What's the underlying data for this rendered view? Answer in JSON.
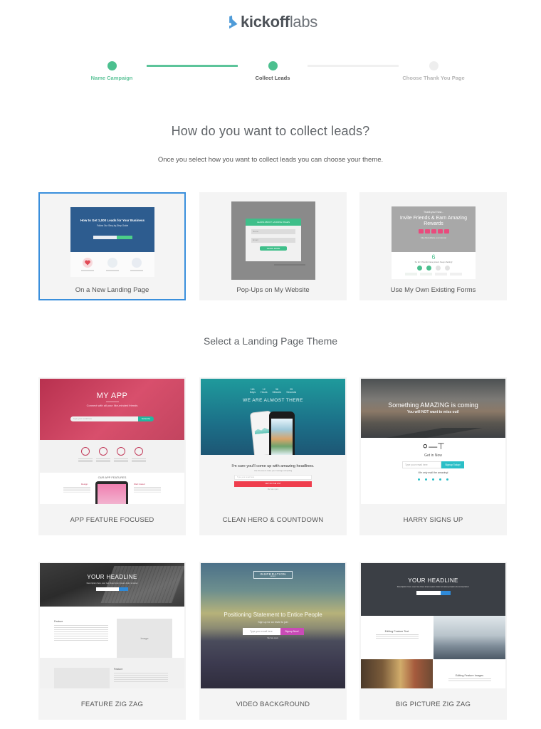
{
  "brand": {
    "name_bold": "kickoff",
    "name_light": "labs",
    "logo_icon": "flask-icon"
  },
  "stepper": {
    "steps": [
      {
        "label": "Name Campaign",
        "state": "completed"
      },
      {
        "label": "Collect Leads",
        "state": "current"
      },
      {
        "label": "Choose Thank You Page",
        "state": "upcoming"
      }
    ],
    "accent_color": "#4cc08f"
  },
  "collect": {
    "title": "How do you want to collect leads?",
    "subtitle": "Once you select how you want to collect leads you can choose your theme.",
    "options": [
      {
        "label": "On a New Landing Page",
        "selected": true,
        "preview": {
          "headline": "How to Get 1,000 Leads for Your Business",
          "subline": "Follow Our Step-by-Step Guide"
        }
      },
      {
        "label": "Pop-Ups on My Website",
        "selected": false,
        "preview": {
          "header": "LEARN ABOUT LANDING PAGES",
          "name_placeholder": "Name",
          "email_placeholder": "Email",
          "button": "LEARN MORE"
        }
      },
      {
        "label": "Use My Own Existing Forms",
        "selected": false,
        "preview": {
          "kicker": "Thank you! Now...",
          "headline": "Invite Friends & Earn Amazing Rewards",
          "count": "6",
          "count_text": "So far 6 friends have joined. Keep sharing!"
        }
      }
    ],
    "selected_color": "#3a8fdc"
  },
  "themes": {
    "title": "Select a Landing Page Theme",
    "items": [
      {
        "label": "APP FEATURE FOCUSED",
        "preview": {
          "title": "MY APP",
          "tagline": "Connect with all your like-minded friends",
          "email_placeholder": "Type your email here",
          "button": "Subscribe",
          "features_heading": "OUR APP FEATURES",
          "left_feature": "Design",
          "right_feature": "Well Coded"
        }
      },
      {
        "label": "CLEAN HERO & COUNTDOWN",
        "preview": {
          "countdown": [
            {
              "value": "161",
              "unit": "Days"
            },
            {
              "value": "12",
              "unit": "Hours"
            },
            {
              "value": "36",
              "unit": "Minutes"
            },
            {
              "value": "25",
              "unit": "Seconds"
            }
          ],
          "headline": "WE ARE ALMOST THERE",
          "body_headline": "I'm sure you'll come up with amazing headlines.",
          "email_placeholder": "Type your email here",
          "button": "GET ON THE LIST"
        }
      },
      {
        "label": "HARRY SIGNS UP",
        "preview": {
          "headline": "Something AMAZING is coming",
          "subline": "You will NOT want to miss out!",
          "cta_heading": "Get in Now",
          "email_placeholder": "Type your email here",
          "button": "Signup Today!",
          "footnote": "We only mail the amazing!"
        }
      },
      {
        "label": "FEATURE ZIG ZAG",
        "preview": {
          "headline": "YOUR HEADLINE",
          "feature_title": "Feature",
          "image_label": "Image"
        }
      },
      {
        "label": "VIDEO BACKGROUND",
        "preview": {
          "logo": "INSPERATION",
          "logo_sub": "GROUP",
          "headline": "Positioning Statement to Entice People",
          "subline": "Sign up for an invite to join",
          "email_placeholder": "Type your email here",
          "button": "Signup Now!",
          "footnote": "We hate spam."
        }
      },
      {
        "label": "BIG PICTURE ZIG ZAG",
        "preview": {
          "headline": "YOUR HEADLINE",
          "description": "Description here over two lines lorem ipsum dolor sit amet proaim alu consectetur.",
          "feature_text": "Editing Feature Text",
          "feature_images": "Editing Feature Images"
        }
      }
    ]
  }
}
